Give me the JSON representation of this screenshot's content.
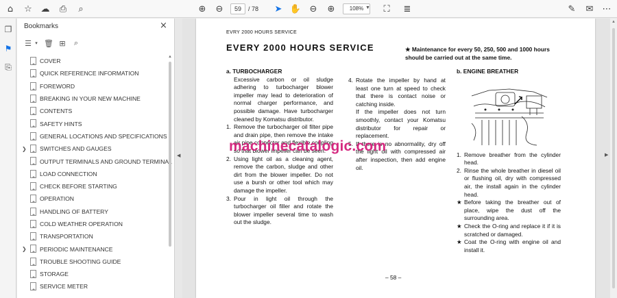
{
  "toolbar": {
    "page_current": "59",
    "page_total": "/ 78",
    "zoom": "108%",
    "icons": [
      "home-icon",
      "bookmark-star-icon",
      "cloud-upload-icon",
      "print-icon",
      "zoom-search-icon",
      "page-up-icon",
      "page-down-icon",
      "select-cursor-icon",
      "hand-tool-icon",
      "zoom-out-icon",
      "zoom-in-icon",
      "fit-page-icon",
      "scroll-mode-icon",
      "annotate-pen-icon",
      "mail-icon",
      "more-icon"
    ]
  },
  "leftrail": {
    "icons": [
      "copy-pages-icon",
      "bookmarks-icon",
      "attachment-icon"
    ]
  },
  "bookmarks": {
    "title": "Bookmarks",
    "items": [
      {
        "label": "COVER",
        "expandable": false
      },
      {
        "label": "QUICK REFERENCE INFORMATION",
        "expandable": false
      },
      {
        "label": "FOREWORD",
        "expandable": false
      },
      {
        "label": "BREAKING IN YOUR NEW MACHINE",
        "expandable": false
      },
      {
        "label": "CONTENTS",
        "expandable": false
      },
      {
        "label": "SAFETY HINTS",
        "expandable": false
      },
      {
        "label": "GENERAL LOCATIONS AND SPECIFICATIONS",
        "expandable": false
      },
      {
        "label": "SWITCHES AND GAUGES",
        "expandable": true
      },
      {
        "label": "OUTPUT TERMINALS AND GROUND TERMINAL",
        "expandable": false
      },
      {
        "label": "LOAD CONNECTION",
        "expandable": false
      },
      {
        "label": "CHECK BEFORE STARTING",
        "expandable": false
      },
      {
        "label": "OPERATION",
        "expandable": false
      },
      {
        "label": "HANDLING OF BATTERY",
        "expandable": false
      },
      {
        "label": "COLD WEATHER OPERATION",
        "expandable": false
      },
      {
        "label": "TRANSPORTATION",
        "expandable": false
      },
      {
        "label": "PERIODIC MAINTENANCE",
        "expandable": true
      },
      {
        "label": "TROUBLE SHOOTING GUIDE",
        "expandable": false
      },
      {
        "label": "STORAGE",
        "expandable": false
      },
      {
        "label": "SERVICE METER",
        "expandable": false
      }
    ]
  },
  "document": {
    "header": "EVRY 2000 HOURS SERVICE",
    "title": "EVERY 2000 HOURS SERVICE",
    "maintenance_note": "★ Maintenance for every 50, 250, 500 and 1000 hours should be carried out at the same time.",
    "sec_a_title": "a.  TURBOCHARGER",
    "sec_a_intro": "Excessive carbon or oil sludge adhering to turbocharger blower impeller may lead to deterioration of normal charger performance, and possible damage. Have turbocharger cleaned by Komatsu distributor.",
    "sec_a_steps": [
      {
        "n": "1.",
        "t": "Remove the turbocharger oil filter pipe and drain pipe, then remove the intake air pipe connector and flexible coupling so that blower impeller can be seen."
      },
      {
        "n": "2.",
        "t": "Using light oil as a cleaning agent, remove the carbon, sludge and other dirt from the blower impeller. Do not use a bursh or other tool which may damage the impeller."
      },
      {
        "n": "3.",
        "t": "Pour in light oil through the turbocharger oil filler and rotate the blower impeller several time to wash out the sludge."
      }
    ],
    "sec_a_steps_2": [
      {
        "n": "4.",
        "t": "Rotate the impeller by hand at least one turn at speed to check that there is contact noise or catching inside."
      },
      {
        "n": "",
        "t": "If the impeller does not turn smoothly, contact your Komatsu distributor for repair or replacement."
      },
      {
        "n": "5.",
        "t": "If there is no abnormality, dry off the light oil with compressed air after inspection, then add engine oil."
      }
    ],
    "sec_b_title": "b.  ENGINE BREATHER",
    "sec_b_steps": [
      {
        "n": "1.",
        "t": "Remove breather from the cylinder head."
      },
      {
        "n": "2.",
        "t": "Rinse the whole breather in diesel oil or flushing oil, dry with compressed air, the install again in the cylinder head."
      },
      {
        "n": "★",
        "t": "Before taking the breather out of place, wipe the dust off the surrounding area."
      },
      {
        "n": "★",
        "t": "Check the O-ring and replace it if it is scratched or damaged."
      },
      {
        "n": "★",
        "t": "Coat the O-ring with engine oil and install it."
      }
    ],
    "page_number": "– 58 –",
    "watermark": "machinecatalogic.com"
  }
}
